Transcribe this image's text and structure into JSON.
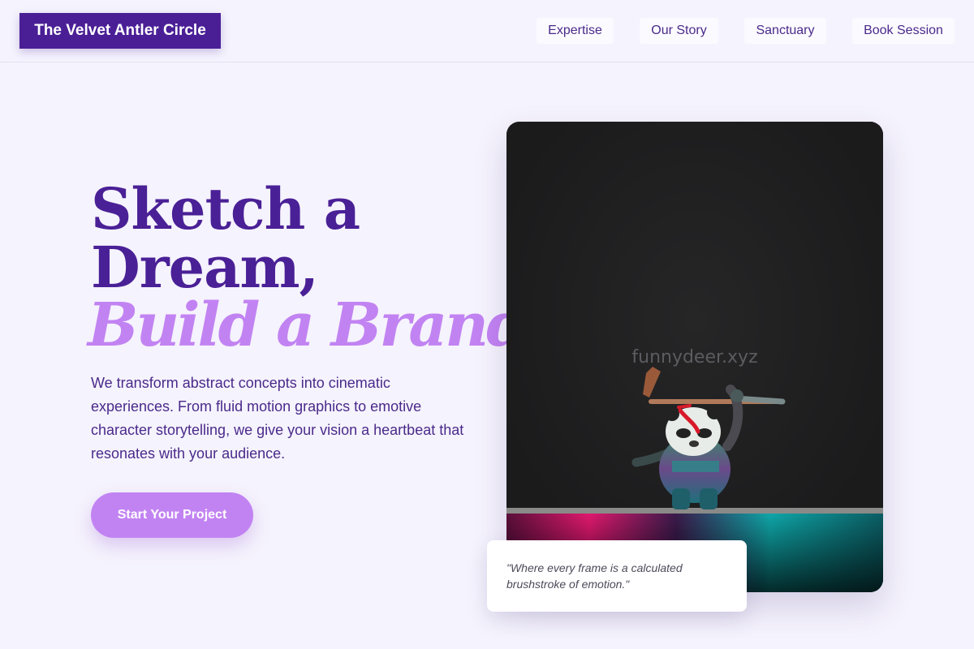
{
  "brand": {
    "name": "The Velvet Antler Circle"
  },
  "nav": {
    "items": [
      {
        "label": "Expertise"
      },
      {
        "label": "Our Story"
      },
      {
        "label": "Sanctuary"
      },
      {
        "label": "Book Session"
      }
    ]
  },
  "hero": {
    "headline_line1": "Sketch a",
    "headline_line2": "Dream,",
    "headline_accent": "Build a Brand.",
    "body": "We transform abstract concepts into cinematic experiences. From fluid motion graphics to emotive character storytelling, we give your vision a heartbeat that resonates with your audience.",
    "cta_label": "Start Your Project"
  },
  "media": {
    "watermark": "funnydeer.xyz",
    "quote": "\"Where every frame is a calculated brushstroke of emotion.\""
  },
  "colors": {
    "background": "#f5f3fd",
    "brand_primary": "#4a1f96",
    "accent": "#c283f2",
    "nav_text": "#4a2a8a"
  }
}
